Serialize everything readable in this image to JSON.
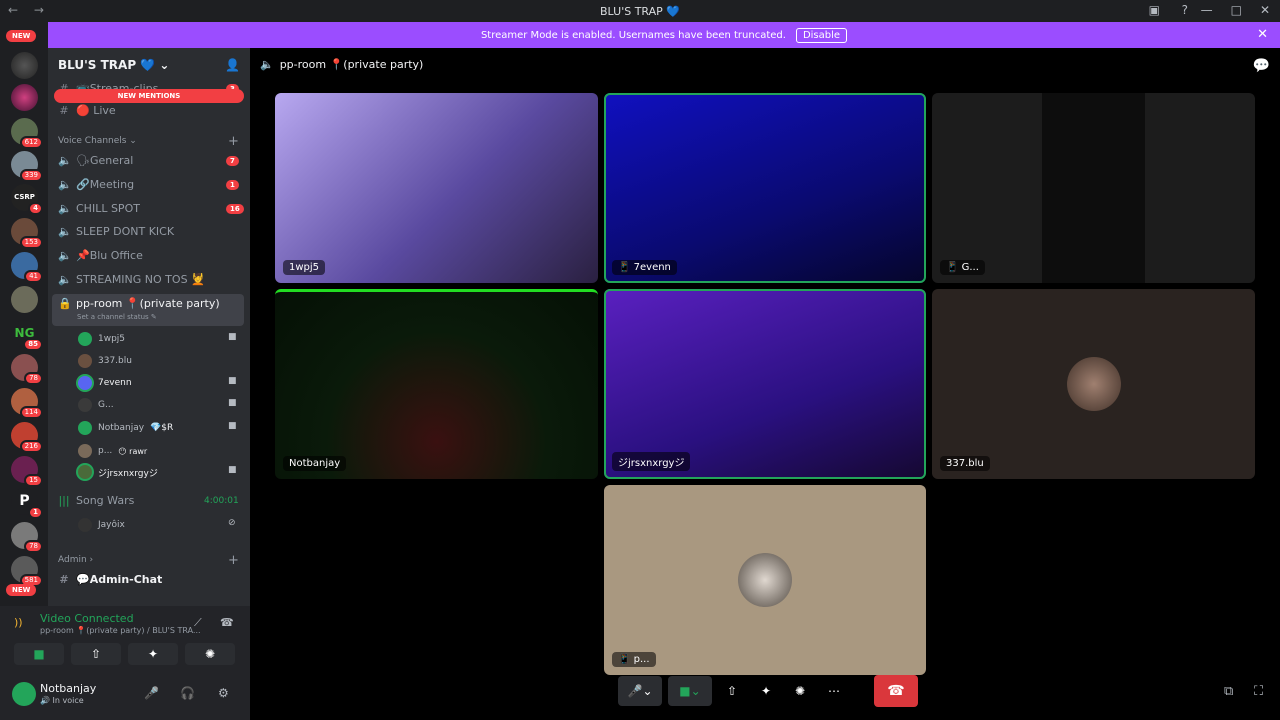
{
  "titlebar": {
    "title": "BLU'S TRAP 💙",
    "nav": "← →"
  },
  "streamer": {
    "message": "Streamer Mode is enabled. Usernames have been truncated.",
    "disable": "Disable"
  },
  "guilds": {
    "new_top": "NEW",
    "new_bottom": "NEW",
    "badges": [
      "612",
      "339",
      "4",
      "153",
      "41",
      "85",
      "78",
      "114",
      "216",
      "15",
      "1",
      "78",
      "581"
    ]
  },
  "server": {
    "name": "BLU'S TRAP 💙 ⌄",
    "new_mentions": "NEW MENTIONS"
  },
  "text_channels": [
    {
      "name": "📺Stream-clips",
      "badge": "3"
    },
    {
      "name": "🔴 Live",
      "badge": ""
    }
  ],
  "voice_category": "Voice Channels ⌄",
  "voice_channels": [
    {
      "name": "🗣General",
      "badge": "7"
    },
    {
      "name": "🔗Meeting",
      "badge": "1"
    },
    {
      "name": "CHILL SPOT",
      "badge": "16"
    },
    {
      "name": "SLEEP DONT KICK",
      "badge": ""
    },
    {
      "name": "📌Blu Office",
      "badge": ""
    },
    {
      "name": "STREAMING NO TOS 💆",
      "badge": ""
    }
  ],
  "active_channel": {
    "name": "pp-room 📍(private party)",
    "status": "Set a channel status ✎"
  },
  "voice_users": [
    {
      "name": "1wpj5",
      "extra": ""
    },
    {
      "name": "337.blu",
      "extra": ""
    },
    {
      "name": "7evenn",
      "extra": ""
    },
    {
      "name": "G...",
      "extra": ""
    },
    {
      "name": "Notbanjay",
      "extra": "💎$R"
    },
    {
      "name": "p...",
      "extra": "😶 rawr"
    },
    {
      "name": "ジjrsxnxrgyジ",
      "extra": ""
    }
  ],
  "song_wars": {
    "name": "Song Wars",
    "time": "4:00:01",
    "user": "Jayôix"
  },
  "admin_category": "Admin ›",
  "admin_chat": "💬Admin-Chat",
  "voice_panel": {
    "title": "Video Connected",
    "subtitle": "pp-room 📍(private party) / BLU'S TRA..."
  },
  "user": {
    "name": "Notbanjay",
    "status": "🔊 In voice"
  },
  "main_header": {
    "channel": "pp-room 📍(private party)"
  },
  "tiles": [
    {
      "label": "1wpj5"
    },
    {
      "label": "📱 7evenn"
    },
    {
      "label": "📱 G..."
    },
    {
      "label": "Notbanjay"
    },
    {
      "label": "ジjrsxnxrgyジ"
    },
    {
      "label": "337.blu"
    },
    {
      "label": "📱 p..."
    }
  ],
  "colors": {
    "accent": "#9b4dff",
    "danger": "#da373c",
    "online": "#23a55a",
    "sidebar": "#2b2d31"
  }
}
